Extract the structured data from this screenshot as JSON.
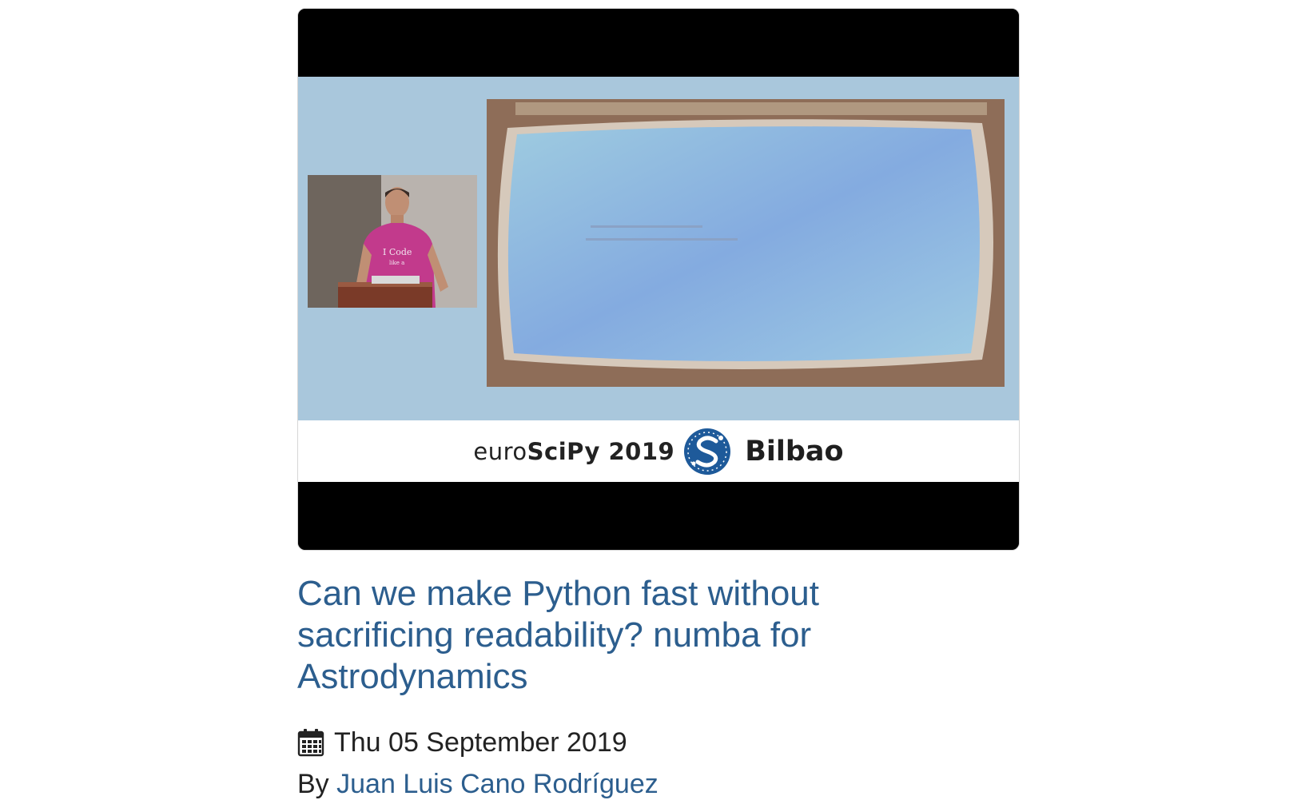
{
  "video": {
    "banner_prefix": "euro",
    "banner_brand": "SciPy 2019",
    "banner_city": "Bilbao",
    "shirt_text": "I Code like a Girl"
  },
  "post": {
    "title": "Can we make Python fast without sacrificing readability? numba for Astrodynamics",
    "date": "Thu 05 September 2019",
    "by_label": "By",
    "author": "Juan Luis Cano Rodríguez"
  },
  "colors": {
    "link": "#2c5e8e",
    "text": "#222222",
    "slide_background": "#a9c7dc"
  },
  "icons": {
    "date": "calendar-icon",
    "logo": "scipy-logo"
  }
}
